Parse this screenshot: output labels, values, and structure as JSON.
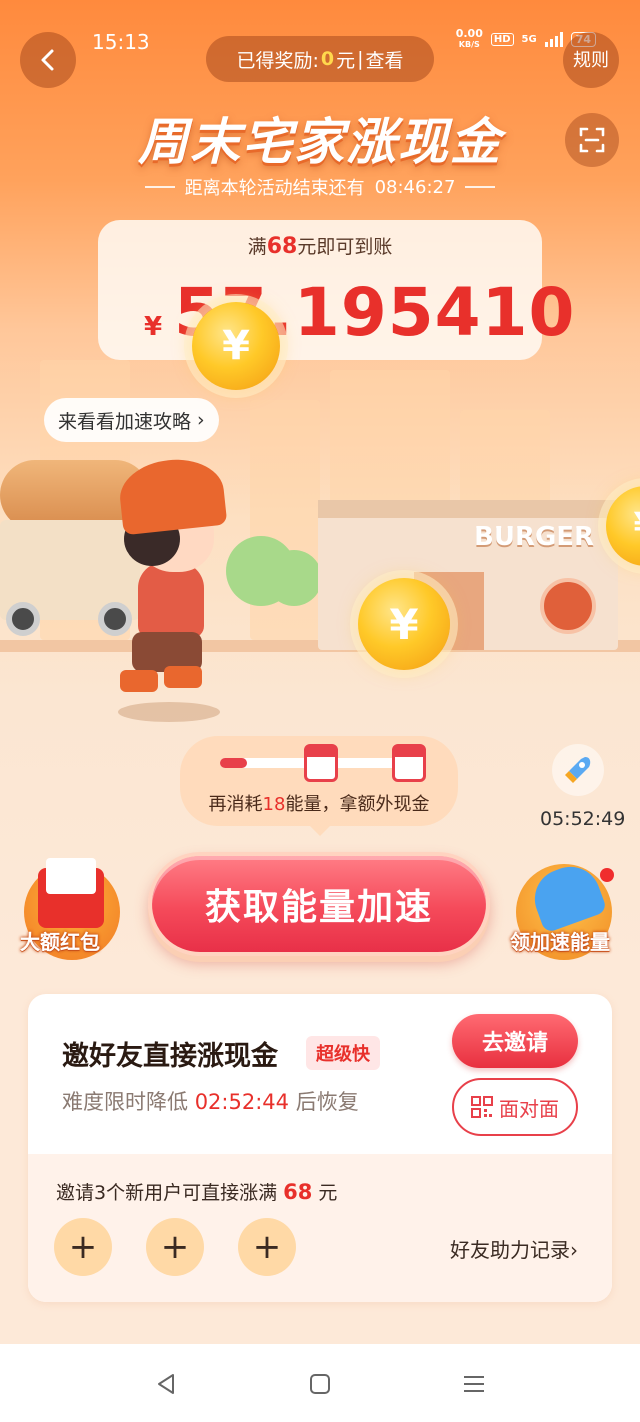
{
  "status_bar": {
    "time": "15:13",
    "net_speed_value": "0.00",
    "net_speed_unit": "KB/S",
    "hd": "HD",
    "network": "5G",
    "battery": "74"
  },
  "header": {
    "reward_label": "已得奖励: ",
    "reward_amount": "0",
    "reward_unit": "元",
    "reward_sep": " | ",
    "reward_view": "查看",
    "rules_label": "规则"
  },
  "title": {
    "main": "周末宅家涨现金",
    "countdown_label": "距离本轮活动结束还有",
    "countdown_time": "08:46:27"
  },
  "cash_card": {
    "goal_prefix": "满",
    "goal_amount": "68",
    "goal_suffix": "元即可到账",
    "currency": "¥",
    "value": "57.195410"
  },
  "scene": {
    "shop_sign": "BURGER",
    "coin_symbol": "¥"
  },
  "tip_bubble": {
    "label": "来看看加速攻略",
    "chevron": "›"
  },
  "progress": {
    "fraction": 0.14,
    "text_prefix": "再消耗",
    "text_amount": "18",
    "text_suffix": "能量，拿额外现金"
  },
  "mini_timer": "05:52:49",
  "actions": {
    "left_label": "大额红包",
    "main_label": "获取能量加速",
    "right_label": "领加速能量"
  },
  "invite": {
    "title": "邀好友直接涨现金",
    "badge": "超级快",
    "sub_prefix": "难度限时降低 ",
    "sub_time": "02:52:44",
    "sub_suffix": " 后恢复",
    "invite_button": "去邀请",
    "f2f_button": "面对面",
    "note_prefix": "邀请3个新用户可直接涨满 ",
    "note_amount": "68",
    "note_suffix": " 元",
    "slots": [
      "+",
      "+",
      "+"
    ],
    "help_link": "好友助力记录",
    "help_chevron": "›"
  },
  "colors": {
    "accent_red": "#e8302b",
    "header_orange": "#ff8a3d",
    "button_pink": "#f54a5a",
    "coin_gold": "#ffc928"
  }
}
